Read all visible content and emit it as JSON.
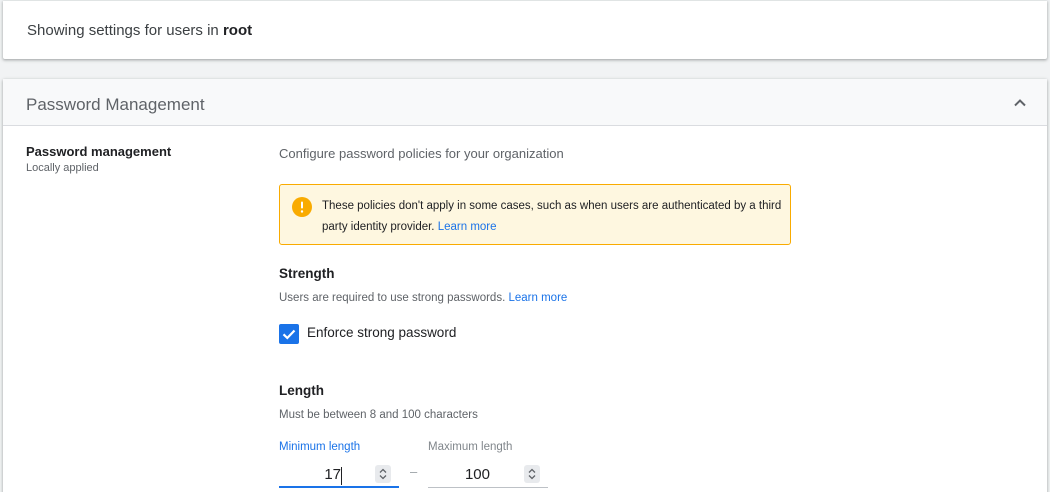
{
  "scope": {
    "prefix": "Showing settings for users in",
    "org_unit": "root"
  },
  "panel": {
    "title": "Password Management",
    "collapse_icon": "chevron-up-icon"
  },
  "setting": {
    "name": "Password management",
    "status": "Locally applied",
    "description": "Configure password policies for your organization"
  },
  "notice": {
    "icon": "warning-icon",
    "text": "These policies don't apply in some cases, such as when users are authenticated by a third party identity provider.",
    "link": "Learn more"
  },
  "strength": {
    "title": "Strength",
    "description": "Users are required to use strong passwords.",
    "link": "Learn more",
    "checkbox_label": "Enforce strong password",
    "checked": true
  },
  "length": {
    "title": "Length",
    "description": "Must be between 8 and 100 characters",
    "min_label": "Minimum length",
    "min_value": "17",
    "separator": "–",
    "max_label": "Maximum length",
    "max_value": "100"
  },
  "colors": {
    "accent": "#1a73e8",
    "warning": "#f9ab00",
    "notice_bg": "#fef7e0"
  }
}
